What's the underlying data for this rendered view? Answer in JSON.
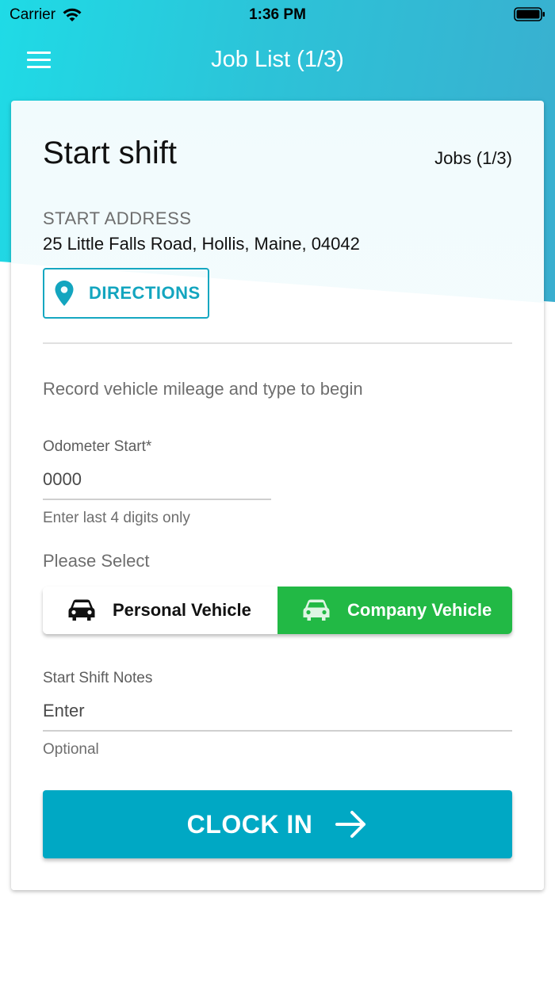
{
  "status_bar": {
    "carrier": "Carrier",
    "time": "1:36 PM"
  },
  "nav": {
    "title": "Job List (1/3)"
  },
  "card": {
    "title": "Start shift",
    "jobs_count": "Jobs (1/3)",
    "address_label": "START ADDRESS",
    "address_value": "25 Little Falls Road, Hollis, Maine, 04042",
    "directions_label": "DIRECTIONS",
    "instructions": "Record vehicle mileage and type to begin",
    "odometer": {
      "label": "Odometer Start*",
      "placeholder": "0000",
      "helper": "Enter last 4 digits only"
    },
    "vehicle_select": {
      "label": "Please Select",
      "options": [
        "Personal Vehicle",
        "Company Vehicle"
      ],
      "selected": "Company Vehicle"
    },
    "notes": {
      "label": "Start Shift Notes",
      "placeholder": "Enter",
      "helper": "Optional"
    },
    "clock_in_label": "CLOCK IN"
  },
  "colors": {
    "header_gradient_start": "#1fdbe6",
    "header_gradient_end": "#3aaecf",
    "accent": "#00a8c4",
    "selected_vehicle": "#22b945"
  }
}
